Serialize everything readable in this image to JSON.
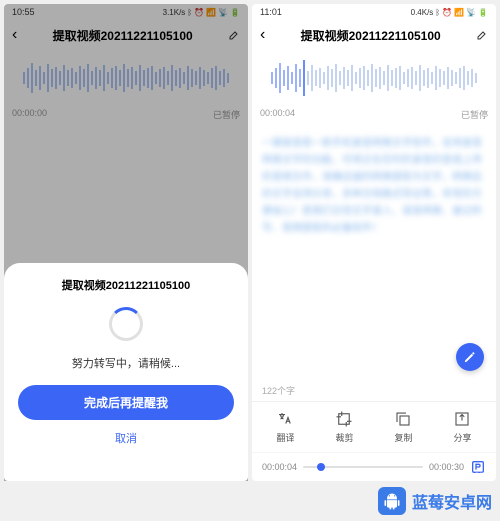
{
  "left": {
    "status": {
      "time": "10:55",
      "net": "3.1K/s"
    },
    "title": "提取视频20211221105100",
    "wave_meta": {
      "start": "00:00:00",
      "status": "已暂停"
    },
    "sheet": {
      "title": "提取视频20211221105100",
      "msg": "努力转写中，请稍候...",
      "primary": "完成后再提醒我",
      "cancel": "取消"
    }
  },
  "right": {
    "status": {
      "time": "11:01",
      "net": "0.4K/s"
    },
    "title": "提取视频20211221105100",
    "wave_meta": {
      "start": "00:00:04",
      "status": "已暂停"
    },
    "transcript": "一键录音是一款手机录音转换文字软件，支持录音转换文字的功能，可将正在实时的录音的音或上传的音频文件，准确迅速的转换提取为文字，转换后的文字支持分享，多种文档格式导出等，非常的方便省心！是我们日常文字录入、语音转换、速记听写、音频提取的必备软件！",
    "count": "122个字",
    "tools": [
      "翻译",
      "裁剪",
      "复制",
      "分享"
    ],
    "player": {
      "cur": "00:00:04",
      "dur": "00:00:30"
    }
  },
  "watermark": {
    "text": "蓝莓安卓网",
    "url": "www.lmkjz.com"
  }
}
